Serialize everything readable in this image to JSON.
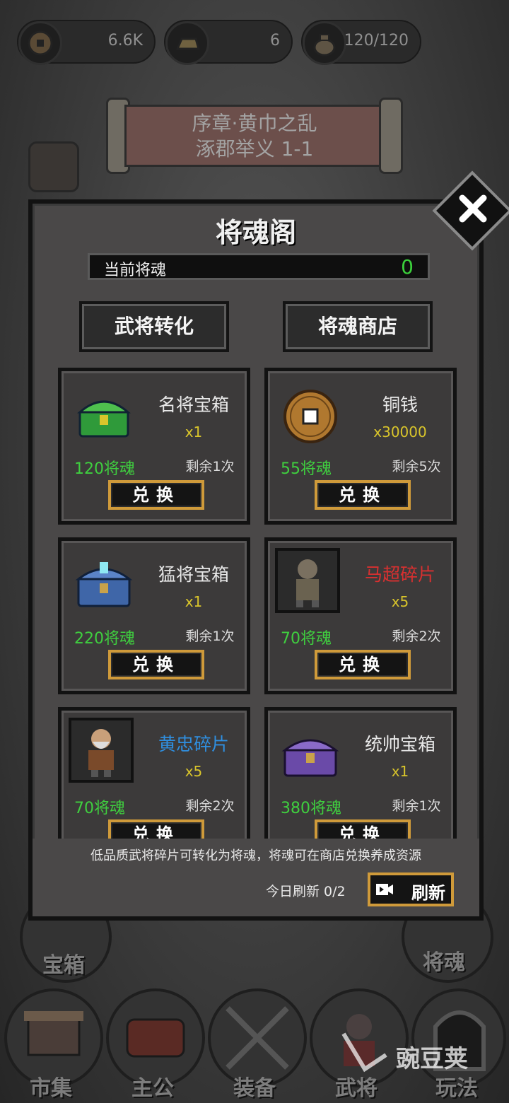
{
  "resources": [
    {
      "icon": "coin-icon",
      "value": "6.6K"
    },
    {
      "icon": "gold-ingot-icon",
      "value": "6"
    },
    {
      "icon": "food-sack-icon",
      "value": "120/120"
    }
  ],
  "chapter": {
    "line1": "序章·黄巾之乱",
    "line2": "涿郡举义 1-1"
  },
  "background_buttons": {
    "treasure_label": "宝箱",
    "general_soul_label": "将魂"
  },
  "bottom_nav": [
    {
      "label": "市集",
      "icon": "store-icon"
    },
    {
      "label": "主公",
      "icon": "lord-icon"
    },
    {
      "label": "装备",
      "icon": "crossed-swords-icon"
    },
    {
      "label": "武将",
      "icon": "general-icon"
    },
    {
      "label": "玩法",
      "icon": "cave-gate-icon"
    }
  ],
  "watermark": "豌豆荚",
  "modal": {
    "title": "将魂阁",
    "current_soul_label": "当前将魂",
    "current_soul_value": "0",
    "convert_button": "武将转化",
    "shop_button": "将魂商店",
    "redeem_label": "兑换",
    "items": [
      {
        "name": "名将宝箱",
        "name_color": "white",
        "icon": "green-chest-icon",
        "qty": "x1",
        "cost": "120将魂",
        "remaining": "剩余1次"
      },
      {
        "name": "铜钱",
        "name_color": "white",
        "icon": "copper-coin-icon",
        "qty": "x30000",
        "cost": "55将魂",
        "remaining": "剩余5次"
      },
      {
        "name": "猛将宝箱",
        "name_color": "white",
        "icon": "blue-chest-icon",
        "qty": "x1",
        "cost": "220将魂",
        "remaining": "剩余1次"
      },
      {
        "name": "马超碎片",
        "name_color": "red",
        "icon": "machao-portrait-icon",
        "qty": "x5",
        "cost": "70将魂",
        "remaining": "剩余2次"
      },
      {
        "name": "黄忠碎片",
        "name_color": "blue",
        "icon": "huangzhong-portrait-icon",
        "qty": "x5",
        "cost": "70将魂",
        "remaining": "剩余2次"
      },
      {
        "name": "统帅宝箱",
        "name_color": "white",
        "icon": "purple-chest-icon",
        "qty": "x1",
        "cost": "380将魂",
        "remaining": "剩余1次"
      }
    ],
    "footer_note": "低品质武将碎片可转化为将魂，将魂可在商店兑换养成资源",
    "refresh_count": "今日刷新 0/2",
    "refresh_button": "刷新"
  },
  "colors": {
    "soul_green": "#3bd03b",
    "qty_yellow": "#d9c52b",
    "button_gold_border": "#cf9a3a",
    "name_red": "#d83030",
    "name_blue": "#2f8fe0"
  }
}
